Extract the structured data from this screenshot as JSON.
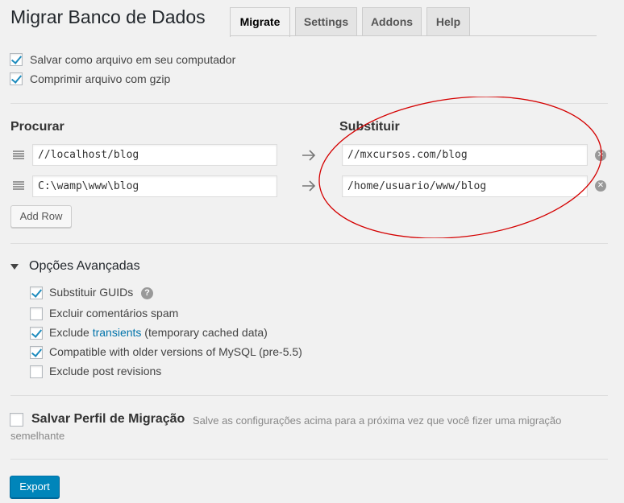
{
  "title": "Migrar Banco de Dados",
  "tabs": [
    {
      "label": "Migrate",
      "active": true
    },
    {
      "label": "Settings",
      "active": false
    },
    {
      "label": "Addons",
      "active": false
    },
    {
      "label": "Help",
      "active": false
    }
  ],
  "options": {
    "save_file": {
      "label": "Salvar como arquivo em seu computador",
      "checked": true
    },
    "gzip": {
      "label": "Comprimir arquivo com gzip",
      "checked": true
    }
  },
  "find_replace": {
    "find_heading": "Procurar",
    "replace_heading": "Substituir",
    "rows": [
      {
        "find": "//localhost/blog",
        "replace": "//mxcursos.com/blog"
      },
      {
        "find": "C:\\wamp\\www\\blog",
        "replace": "/home/usuario/www/blog"
      }
    ],
    "add_row_label": "Add Row"
  },
  "advanced": {
    "heading": "Opções Avançadas",
    "items": [
      {
        "label": "Substituir GUIDs",
        "checked": true,
        "help_icon": "?"
      },
      {
        "label": "Excluir comentários spam",
        "checked": false
      },
      {
        "label_before": "Exclude ",
        "link": "transients",
        "label_after": " (temporary cached data)",
        "checked": true
      },
      {
        "label": "Compatible with older versions of MySQL (pre-5.5)",
        "checked": true
      },
      {
        "label": "Exclude post revisions",
        "checked": false
      }
    ]
  },
  "profile": {
    "label": "Salvar Perfil de Migração",
    "description_line1": "Salve as configurações acima para a próxima vez que você fizer uma migração",
    "description_line2": "semelhante",
    "checked": false
  },
  "export_label": "Export",
  "colors": {
    "accent": "#0085ba",
    "annotation": "#d40000",
    "checkmark": "#1e8cbe"
  }
}
